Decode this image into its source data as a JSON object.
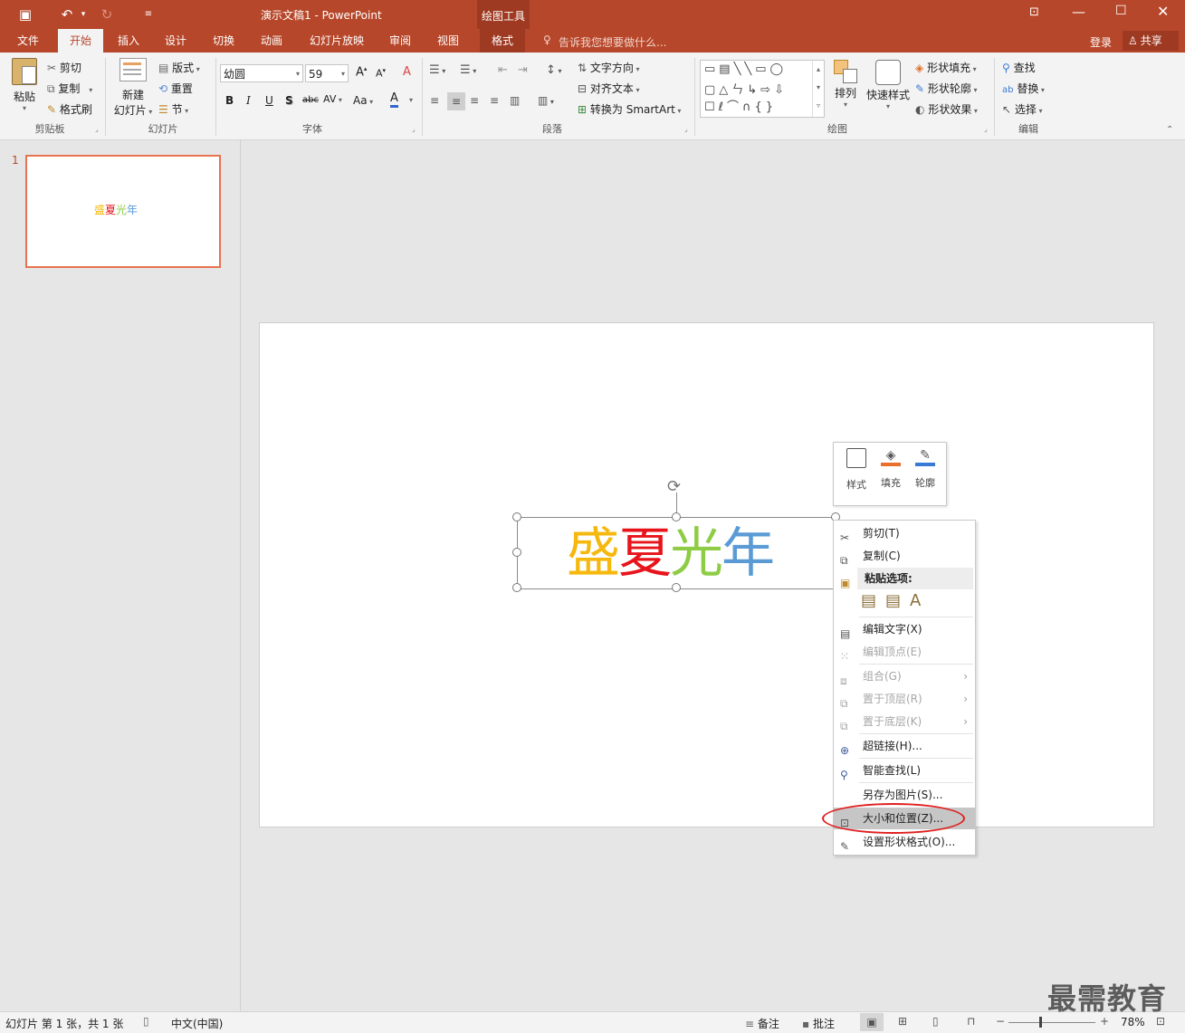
{
  "title_bar": {
    "doc_title": "演示文稿1 - PowerPoint",
    "context_tool": "绘图工具",
    "login": "登录",
    "share": "共享",
    "window_controls": [
      "ribbon-display-icon",
      "minimize-icon",
      "maximize-icon",
      "close-icon"
    ]
  },
  "tabs": [
    "文件",
    "开始",
    "插入",
    "设计",
    "切换",
    "动画",
    "幻灯片放映",
    "审阅",
    "视图",
    "格式"
  ],
  "tell_me": "告诉我您想要做什么...",
  "ribbon": {
    "clipboard": {
      "paste": "粘贴",
      "cut": "剪切",
      "copy": "复制",
      "format_painter": "格式刷",
      "label": "剪贴板"
    },
    "slides": {
      "new_slide_line1": "新建",
      "new_slide_line2": "幻灯片",
      "layout": "版式",
      "reset": "重置",
      "section": "节",
      "label": "幻灯片"
    },
    "font": {
      "font_name": "幼圆",
      "font_size": "59",
      "bold": "B",
      "italic": "I",
      "underline": "U",
      "shadow": "S",
      "strike": "abc",
      "spacing": "AV",
      "case": "Aa",
      "label": "字体"
    },
    "paragraph": {
      "text_direction": "文字方向",
      "align_text": "对齐文本",
      "smartart": "转换为 SmartArt",
      "label": "段落"
    },
    "drawing": {
      "arrange": "排列",
      "quick_styles": "快速样式",
      "shape_fill": "形状填充",
      "shape_outline": "形状轮廓",
      "shape_effects": "形状效果",
      "label": "绘图"
    },
    "editing": {
      "find": "查找",
      "replace": "替换",
      "select": "选择",
      "label": "编辑"
    }
  },
  "thumbnail": {
    "number": "1",
    "text_parts": [
      "盛",
      "夏",
      "光",
      "年"
    ]
  },
  "slide_text": {
    "parts": [
      "盛",
      "夏",
      "光",
      "年"
    ],
    "colors": [
      "#f6b80e",
      "#e8141b",
      "#8fcc45",
      "#5b9bd5"
    ]
  },
  "mini_toolbar": {
    "style": "样式",
    "fill": "填充",
    "outline": "轮廓"
  },
  "context_menu": {
    "cut": "剪切(T)",
    "copy": "复制(C)",
    "paste_options": "粘贴选项:",
    "edit_text": "编辑文字(X)",
    "edit_points": "编辑顶点(E)",
    "group": "组合(G)",
    "bring_front": "置于顶层(R)",
    "send_back": "置于底层(K)",
    "hyperlink": "超链接(H)...",
    "smart_lookup": "智能查找(L)",
    "save_as_picture": "另存为图片(S)...",
    "size_position": "大小和位置(Z)...",
    "format_shape": "设置形状格式(O)..."
  },
  "status_bar": {
    "slide_info": "幻灯片 第 1 张，共 1 张",
    "language": "中文(中国)",
    "notes": "备注",
    "comments": "批注",
    "zoom": "78%"
  },
  "watermark": "最需教育"
}
